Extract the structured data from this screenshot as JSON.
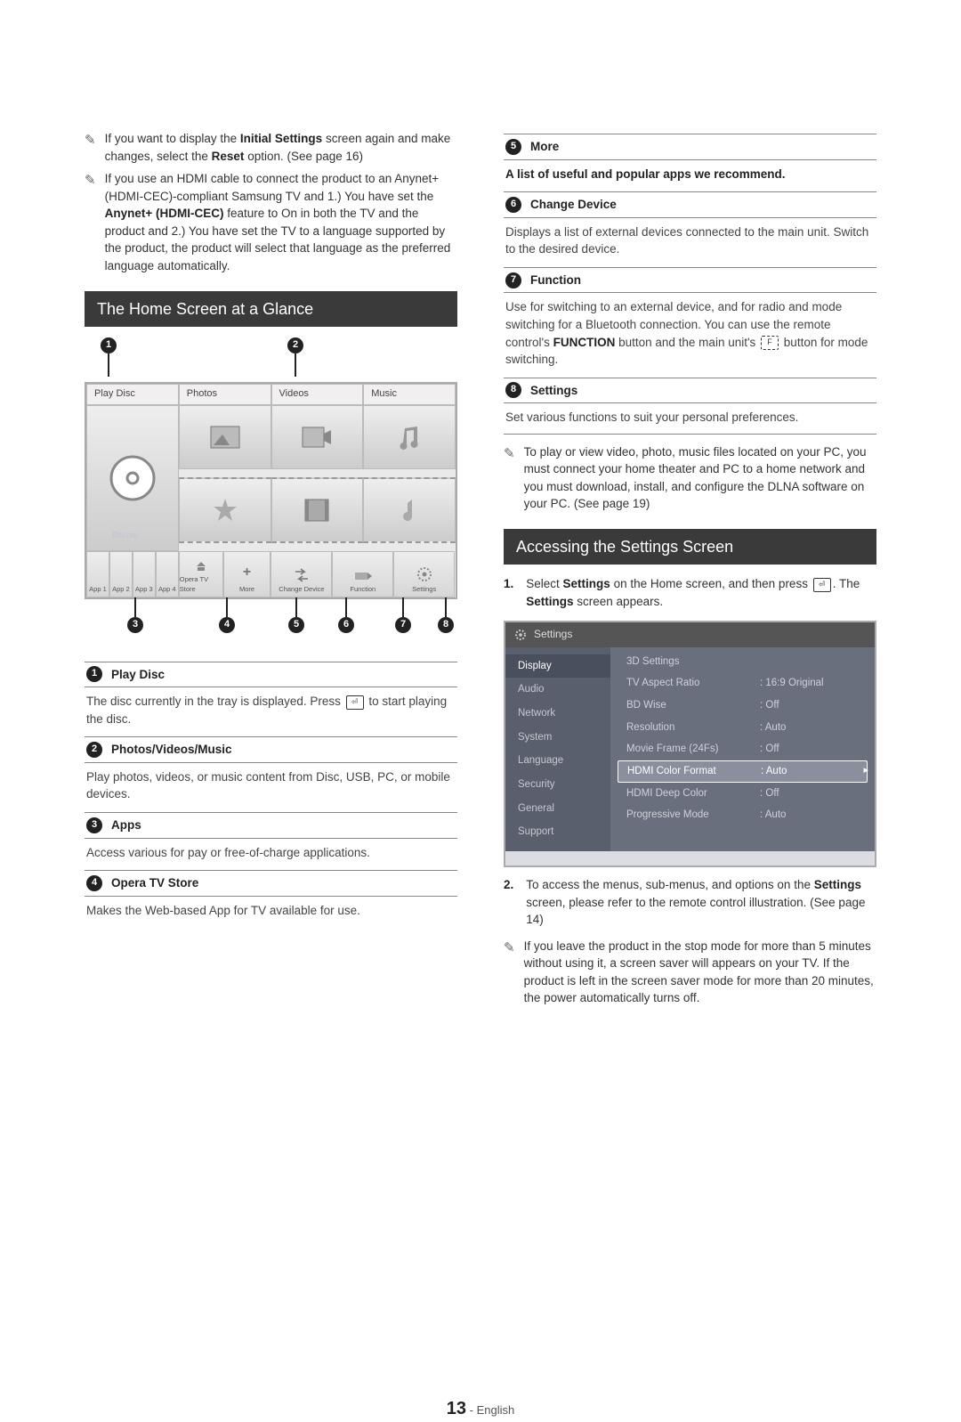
{
  "left": {
    "notes": [
      {
        "pre": "If you want to display the ",
        "b1": "Initial Settings",
        "mid": " screen again and make changes, select the ",
        "b2": "Reset",
        "post": " option. (See page 16)"
      },
      {
        "pre": "If you use an HDMI cable to connect the product to an Anynet+ (HDMI-CEC)-compliant Samsung TV and 1.) You have set the ",
        "b1": "Anynet+ (HDMI-CEC)",
        "mid": " feature to On in both the TV and the product and 2.) You have set the TV to a language supported by the product, the product will select that language as the preferred language automatically.",
        "b2": "",
        "post": ""
      }
    ],
    "sec1": "The Home Screen at a Glance",
    "home": {
      "tabs": [
        "Play Disc",
        "Photos",
        "Videos",
        "Music"
      ],
      "bluray": "Blu-ray",
      "apps": [
        "App 1",
        "App 2",
        "App 3",
        "App 4",
        "Opera TV Store"
      ],
      "more": "More",
      "rtiles": [
        "Change Device",
        "Function",
        "Settings"
      ]
    },
    "items": [
      {
        "n": "1",
        "t": "Play Disc",
        "d1": "The disc currently in the tray is displayed. Press ",
        "d2": " to start playing the disc."
      },
      {
        "n": "2",
        "t": "Photos/Videos/Music",
        "d": "Play photos, videos, or music content from Disc, USB, PC, or mobile devices."
      },
      {
        "n": "3",
        "t": "Apps",
        "d": "Access various for pay or free-of-charge applications."
      },
      {
        "n": "4",
        "t": "Opera TV Store",
        "d": "Makes the Web-based App for TV available for use."
      }
    ]
  },
  "right": {
    "items": [
      {
        "n": "5",
        "t": "More",
        "d": "A list of useful and popular apps we recommend."
      },
      {
        "n": "6",
        "t": "Change Device",
        "d": "Displays a list of external devices connected to the main unit. Switch to the desired device."
      },
      {
        "n": "7",
        "t": "Function",
        "d1": "Use for switching to an external device, and for radio and mode switching for a Bluetooth connection. You can use the remote control's ",
        "b1": "FUNCTION",
        "d2": " button and the main unit's ",
        "d3": " button for mode switching."
      },
      {
        "n": "8",
        "t": "Settings",
        "d": "Set various functions to suit your personal preferences."
      }
    ],
    "pcnote": "To play or view video, photo, music files located on your PC, you must connect your home theater and PC to a home network and you must download, install, and configure the DLNA software on your PC. (See page 19)",
    "sec2": "Accessing the Settings Screen",
    "step1a": "Select ",
    "step1b": "Settings",
    "step1c": " on the Home screen, and then press ",
    "step1d": ". The ",
    "step1e": "Settings",
    "step1f": " screen appears.",
    "settings": {
      "title": "Settings",
      "nav": [
        "Display",
        "Audio",
        "Network",
        "System",
        "Language",
        "Security",
        "General",
        "Support"
      ],
      "rows": [
        {
          "l": "3D Settings",
          "v": ""
        },
        {
          "l": "TV Aspect Ratio",
          "v": "16:9 Original"
        },
        {
          "l": "BD Wise",
          "v": "Off"
        },
        {
          "l": "Resolution",
          "v": "Auto"
        },
        {
          "l": "Movie Frame (24Fs)",
          "v": "Off"
        },
        {
          "l": "HDMI Color Format",
          "v": "Auto",
          "sel": true
        },
        {
          "l": "HDMI Deep Color",
          "v": "Off"
        },
        {
          "l": "Progressive Mode",
          "v": "Auto"
        }
      ]
    },
    "step2a": "To access the menus, sub-menus, and options on the ",
    "step2b": "Settings",
    "step2c": " screen, please refer to the remote control illustration. (See page 14)",
    "stopnote": "If you leave the product in the stop mode for more than 5 minutes without using it, a screen saver will appears on your TV. If the product is left in the screen saver mode for more than 20 minutes, the power automatically turns off."
  },
  "footer": {
    "page": "13",
    "lang": "English"
  }
}
